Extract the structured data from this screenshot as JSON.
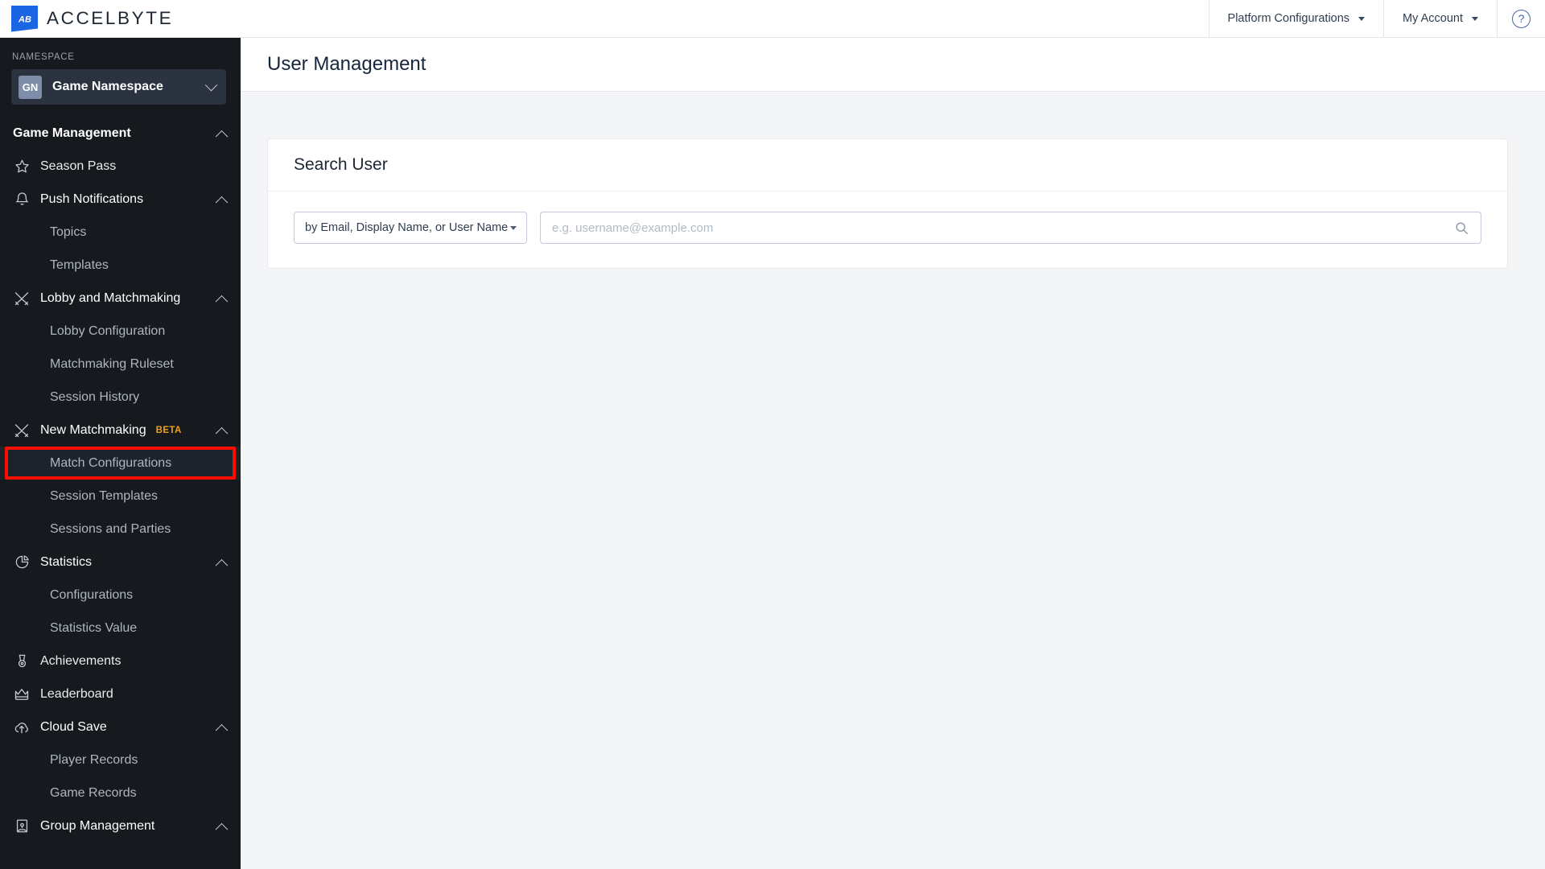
{
  "brand": {
    "name": "ACCELBYTE",
    "mark_initials": "AB",
    "mark_color": "#1b64e3"
  },
  "topnav": {
    "items": [
      {
        "label": "Platform Configurations",
        "icon": "chevron-down-icon"
      },
      {
        "label": "My Account",
        "icon": "chevron-down-icon"
      }
    ],
    "help": {
      "icon": "help-circle-icon",
      "glyph": "?"
    }
  },
  "sidebar": {
    "namespace_label": "NAMESPACE",
    "namespace": {
      "initials": "GN",
      "name": "Game Namespace",
      "icon": "chevron-down-icon"
    },
    "nav": [
      {
        "type": "section",
        "label": "Game Management",
        "expanded": true,
        "icon": "chevron-up-icon"
      },
      {
        "type": "item",
        "label": "Season Pass",
        "icon": "star-icon"
      },
      {
        "type": "item",
        "label": "Push Notifications",
        "icon": "bell-icon",
        "expanded": true,
        "chevron": "chevron-up-icon"
      },
      {
        "type": "sub",
        "label": "Topics"
      },
      {
        "type": "sub",
        "label": "Templates"
      },
      {
        "type": "item",
        "label": "Lobby and Matchmaking",
        "icon": "swords-icon",
        "expanded": true,
        "chevron": "chevron-up-icon"
      },
      {
        "type": "sub",
        "label": "Lobby Configuration"
      },
      {
        "type": "sub",
        "label": "Matchmaking Ruleset"
      },
      {
        "type": "sub",
        "label": "Session History"
      },
      {
        "type": "item",
        "label": "New Matchmaking",
        "icon": "swords-icon",
        "badge": "BETA",
        "badge_color": "#f0a01e",
        "expanded": true,
        "chevron": "chevron-up-icon"
      },
      {
        "type": "sub",
        "label": "Match Configurations",
        "selected": true,
        "highlighted": true
      },
      {
        "type": "sub",
        "label": "Session Templates"
      },
      {
        "type": "sub",
        "label": "Sessions and Parties"
      },
      {
        "type": "item",
        "label": "Statistics",
        "icon": "pie-chart-icon",
        "expanded": true,
        "chevron": "chevron-up-icon"
      },
      {
        "type": "sub",
        "label": "Configurations"
      },
      {
        "type": "sub",
        "label": "Statistics Value"
      },
      {
        "type": "item",
        "label": "Achievements",
        "icon": "medal-icon"
      },
      {
        "type": "item",
        "label": "Leaderboard",
        "icon": "crown-icon"
      },
      {
        "type": "item",
        "label": "Cloud Save",
        "icon": "cloud-upload-icon",
        "expanded": true,
        "chevron": "chevron-up-icon"
      },
      {
        "type": "sub",
        "label": "Player Records"
      },
      {
        "type": "sub",
        "label": "Game Records"
      },
      {
        "type": "item",
        "label": "Group Management",
        "icon": "banner-icon",
        "expanded": true,
        "chevron": "chevron-up-icon"
      }
    ],
    "highlight_color": "#fd0d00"
  },
  "page": {
    "title": "User Management"
  },
  "search_card": {
    "title": "Search User",
    "filter": {
      "selected": "by Email, Display Name, or User Name",
      "icon": "chevron-down-icon"
    },
    "input": {
      "value": "",
      "placeholder": "e.g. username@example.com"
    },
    "search_icon": "search-icon"
  }
}
